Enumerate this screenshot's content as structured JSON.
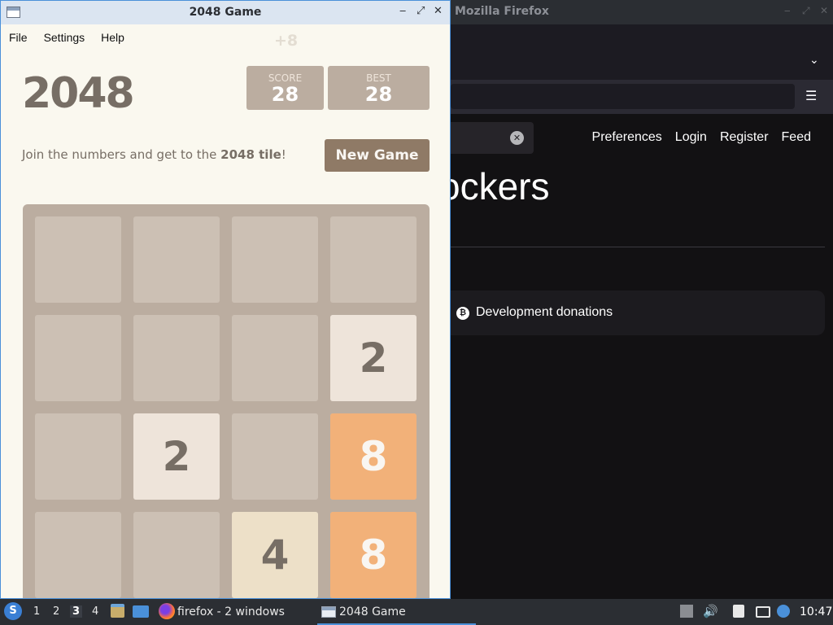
{
  "firefox": {
    "window_title": "Mozilla Firefox",
    "tabs_chevron": "⌄",
    "menu_icon": "hamburger-menu-icon",
    "search_clear": "✕",
    "nav": [
      "Preferences",
      "Login",
      "Register",
      "Feed"
    ],
    "heading": "ockers",
    "donation_label": "Development donations",
    "donation_icon": "₿"
  },
  "game": {
    "window_title": "2048 Game",
    "window_controls": [
      "‒",
      "⤢",
      "✕"
    ],
    "menu": [
      "File",
      "Settings",
      "Help"
    ],
    "score_popup": "+8",
    "logo": "2048",
    "score": {
      "label": "SCORE",
      "value": "28"
    },
    "best": {
      "label": "BEST",
      "value": "28"
    },
    "intro_prefix": "Join the numbers and get to the ",
    "intro_bold": "2048 tile",
    "intro_suffix": "!",
    "new_game_label": "New Game",
    "grid": [
      [
        null,
        null,
        null,
        null
      ],
      [
        null,
        null,
        null,
        2
      ],
      [
        null,
        2,
        null,
        8
      ],
      [
        null,
        null,
        4,
        8
      ]
    ],
    "tile_colors": {
      "2": {
        "bg": "#eee4da",
        "fg": "#776e65"
      },
      "4": {
        "bg": "#ede0c8",
        "fg": "#776e65"
      },
      "8": {
        "bg": "#f2b179",
        "fg": "#f9f6f2"
      }
    }
  },
  "taskbar": {
    "start_icon": "S",
    "workspaces": [
      "1",
      "2",
      "3",
      "4"
    ],
    "active_workspace": "3",
    "firefox_task": "firefox - 2 windows",
    "game_task": "2048 Game",
    "volume_icon": "🔊",
    "clock": "10:47"
  }
}
